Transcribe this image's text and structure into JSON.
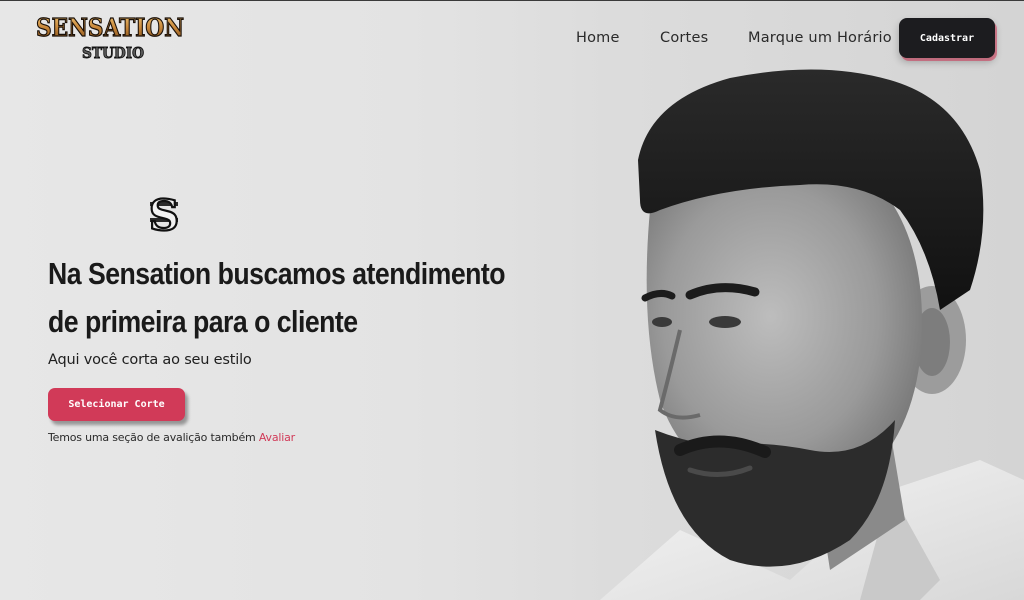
{
  "brand": {
    "logo_line1": "SENSATION",
    "logo_line2": "STUDIO",
    "emblem_letter": "S"
  },
  "nav": {
    "items": [
      {
        "label": "Home"
      },
      {
        "label": "Cortes"
      },
      {
        "label": "Marque um Horário"
      }
    ],
    "cta_label": "Cadastrar"
  },
  "hero": {
    "title": "Na Sensation buscamos atendimento de primeira para o cliente",
    "subtitle": "Aqui você corta ao seu estilo",
    "button_label": "Selecionar Corte",
    "review_text": "Temos uma seção de avalição também ",
    "review_link": "Avaliar"
  },
  "colors": {
    "accent": "#d13a58",
    "dark_button": "#1c1c1f",
    "background": "#e3e3e3"
  }
}
